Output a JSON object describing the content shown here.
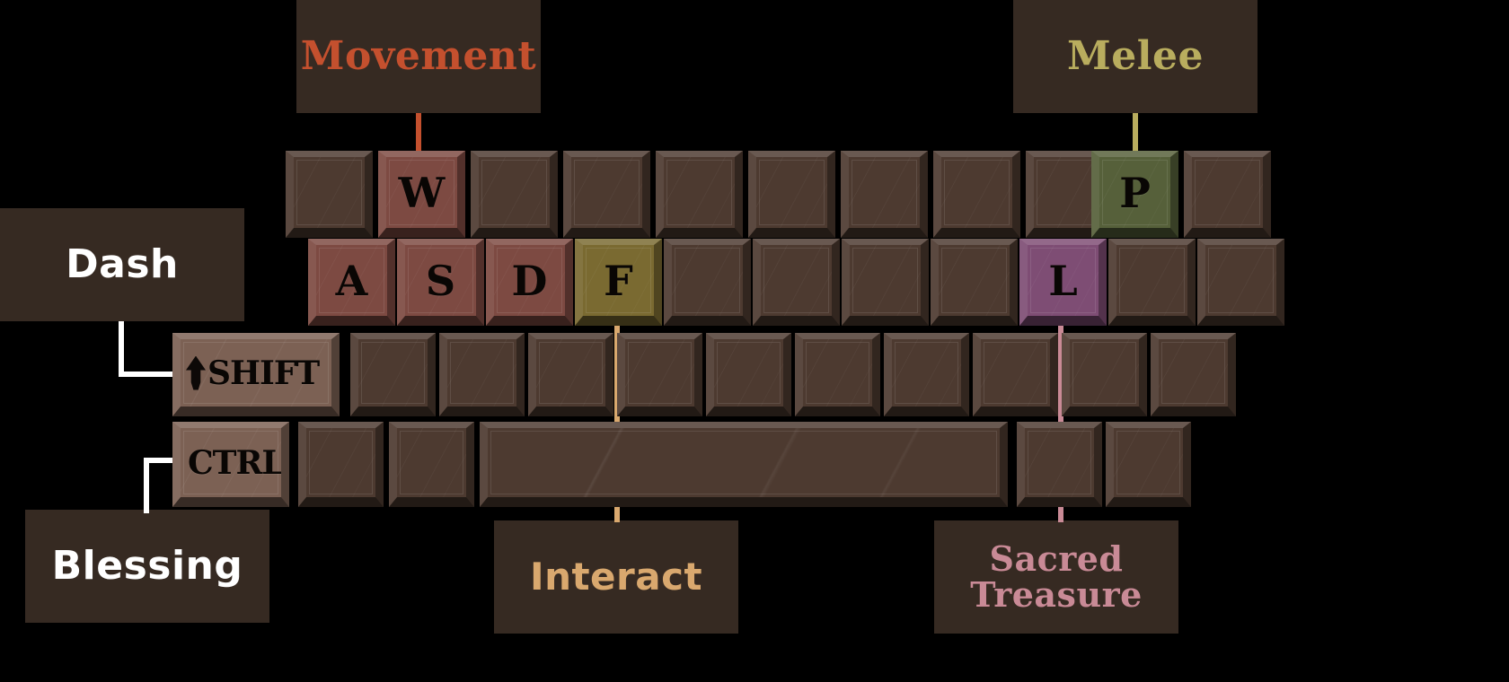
{
  "legend": {
    "movement": {
      "label": "Movement",
      "color": "#c4502e",
      "key": "W"
    },
    "melee": {
      "label": "Melee",
      "color": "#b9ad5e",
      "key": "P"
    },
    "dash": {
      "label": "Dash",
      "color": "#ffffff",
      "key": "SHIFT"
    },
    "blessing": {
      "label": "Blessing",
      "color": "#ffffff",
      "key": "CTRL"
    },
    "interact": {
      "label": "Interact",
      "color": "#d9a86e",
      "key": "F"
    },
    "treasure": {
      "label": "Sacred\nTreasure",
      "color": "#c98a96",
      "key": "L"
    }
  },
  "panel_bg": "#362a22",
  "keyboard": {
    "row1": [
      {
        "cap": "",
        "highlight": null
      },
      {
        "cap": "W",
        "highlight": "movement"
      },
      {
        "cap": "",
        "highlight": null
      },
      {
        "cap": "",
        "highlight": null
      },
      {
        "cap": "",
        "highlight": null
      },
      {
        "cap": "",
        "highlight": null
      },
      {
        "cap": "",
        "highlight": null
      },
      {
        "cap": "",
        "highlight": null
      },
      {
        "cap": "",
        "highlight": null
      },
      {
        "cap": "P",
        "highlight": "melee"
      },
      {
        "cap": "",
        "highlight": null
      }
    ],
    "row2": [
      {
        "cap": "A",
        "highlight": "movement"
      },
      {
        "cap": "S",
        "highlight": "movement"
      },
      {
        "cap": "D",
        "highlight": "movement"
      },
      {
        "cap": "F",
        "highlight": "interact"
      },
      {
        "cap": "",
        "highlight": null
      },
      {
        "cap": "",
        "highlight": null
      },
      {
        "cap": "",
        "highlight": null
      },
      {
        "cap": "",
        "highlight": null
      },
      {
        "cap": "L",
        "highlight": "treasure"
      },
      {
        "cap": "",
        "highlight": null
      },
      {
        "cap": "",
        "highlight": null
      }
    ],
    "row3": [
      {
        "cap": "SHIFT",
        "arrow": "arrow-up-icon",
        "highlight": "dash"
      },
      {
        "cap": "",
        "highlight": null
      },
      {
        "cap": "",
        "highlight": null
      },
      {
        "cap": "",
        "highlight": null
      },
      {
        "cap": "",
        "highlight": null
      },
      {
        "cap": "",
        "highlight": null
      },
      {
        "cap": "",
        "highlight": null
      },
      {
        "cap": "",
        "highlight": null
      },
      {
        "cap": "",
        "highlight": null
      },
      {
        "cap": "",
        "highlight": null
      },
      {
        "cap": "",
        "highlight": null
      }
    ],
    "row4": [
      {
        "cap": "CTRL",
        "highlight": "blessing"
      },
      {
        "cap": "",
        "highlight": null
      },
      {
        "cap": "",
        "highlight": null
      },
      {
        "cap": "",
        "highlight": null
      },
      {
        "cap": "",
        "highlight": null
      },
      {
        "cap": "",
        "highlight": null
      }
    ]
  },
  "key_colors": {
    "default": "#4d3a30",
    "movement": "#7d4a42",
    "melee": "#56603a",
    "interact": "#7a6a31",
    "treasure": "#7e4d74",
    "dash": "#7c6154",
    "blessing": "#7c6154"
  }
}
